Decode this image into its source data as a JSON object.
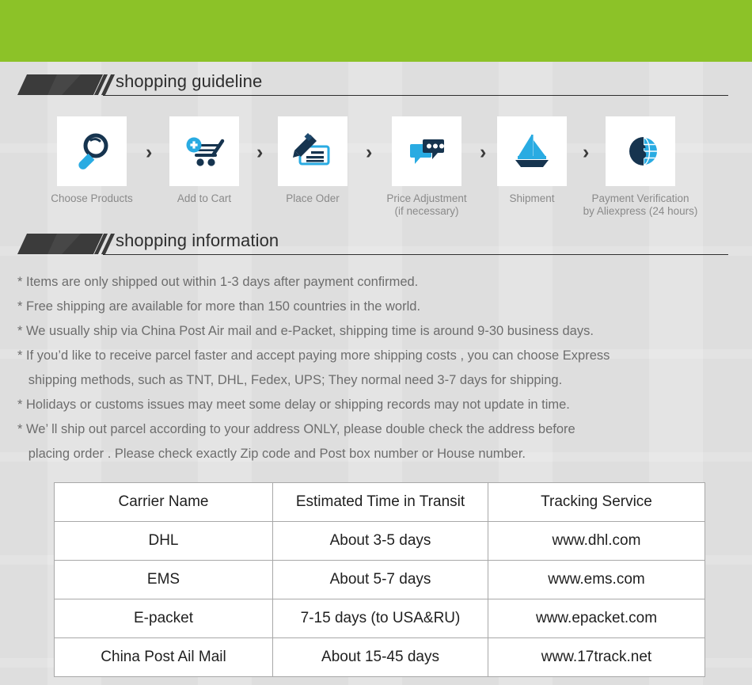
{
  "banner": {
    "color": "#8cc228"
  },
  "sections": {
    "guideline": {
      "title": "shopping guideline"
    },
    "information": {
      "title": "shopping information"
    }
  },
  "steps": {
    "separator": "›",
    "items": [
      {
        "label": "Choose Products",
        "icon": "magnifier-icon"
      },
      {
        "label": "Add to Cart",
        "icon": "cart-plus-icon"
      },
      {
        "label": "Place Oder",
        "icon": "pen-check-icon"
      },
      {
        "label": "Price Adjustment\n(if necessary)",
        "icon": "chat-bubbles-icon"
      },
      {
        "label": "Shipment",
        "icon": "sailboat-icon"
      },
      {
        "label": "Payment Verification\nby  Aliexpress (24 hours)",
        "icon": "dollar-globe-icon"
      }
    ]
  },
  "information_lines": [
    "* Items are only shipped out within 1-3 days after payment confirmed.",
    "* Free shipping are available for more than 150 countries in the world.",
    "* We usually ship via China Post Air mail and e-Packet, shipping time is around 9-30 business days.",
    "* If you’d like to receive parcel faster and accept paying more shipping costs , you can choose Express",
    "   shipping methods, such as TNT, DHL, Fedex, UPS; They normal need 3-7 days for shipping.",
    "* Holidays or customs issues may meet some delay or shipping records may not update in time.",
    "* We’ ll ship out parcel according to your address ONLY, please double check the address before",
    "   placing order . Please check exactly Zip code and Post box number or House number."
  ],
  "carrier_table": {
    "headers": [
      "Carrier Name",
      "Estimated Time in Transit",
      "Tracking Service"
    ],
    "rows": [
      [
        "DHL",
        "About 3-5 days",
        "www.dhl.com"
      ],
      [
        "EMS",
        "About 5-7 days",
        "www.ems.com"
      ],
      [
        "E-packet",
        "7-15 days (to USA&RU)",
        "www.epacket.com"
      ],
      [
        "China Post Ail Mail",
        "About 15-45 days",
        "www.17track.net"
      ]
    ]
  },
  "colors": {
    "banner_green": "#8cc228",
    "page_bg": "#dedede",
    "icon_dark": "#16344f",
    "icon_blue": "#29abe2",
    "heading_dark": "#2e2e2e",
    "body_text": "#6d6d6d"
  }
}
